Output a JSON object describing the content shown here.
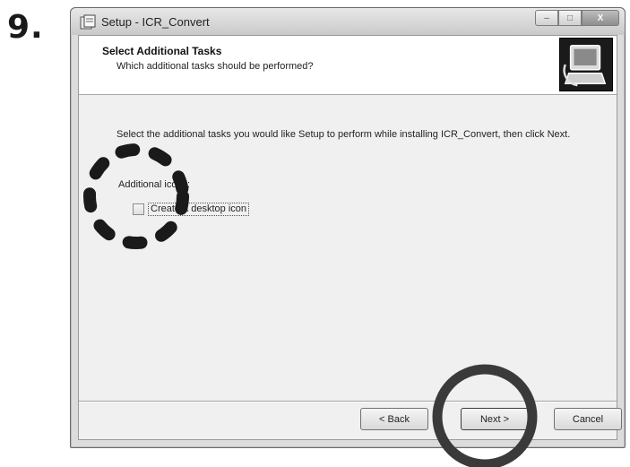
{
  "step_number": "9.",
  "window": {
    "title": "Setup - ICR_Convert",
    "controls": {
      "minimize": "–",
      "maximize": "□",
      "close": "X"
    }
  },
  "header": {
    "title": "Select Additional Tasks",
    "subtitle": "Which additional tasks should be performed?"
  },
  "body": {
    "description": "Select the additional tasks you would like Setup to perform while installing ICR_Convert, then click Next.",
    "section_label": "Additional icons:",
    "checkbox": {
      "label": "Create a desktop icon",
      "checked": false
    }
  },
  "buttons": {
    "back": "< Back",
    "next": "Next >",
    "cancel": "Cancel"
  },
  "annotations": {
    "dashed_circle_color": "#1a1a1a",
    "solid_circle_color": "#3a3a3a"
  }
}
